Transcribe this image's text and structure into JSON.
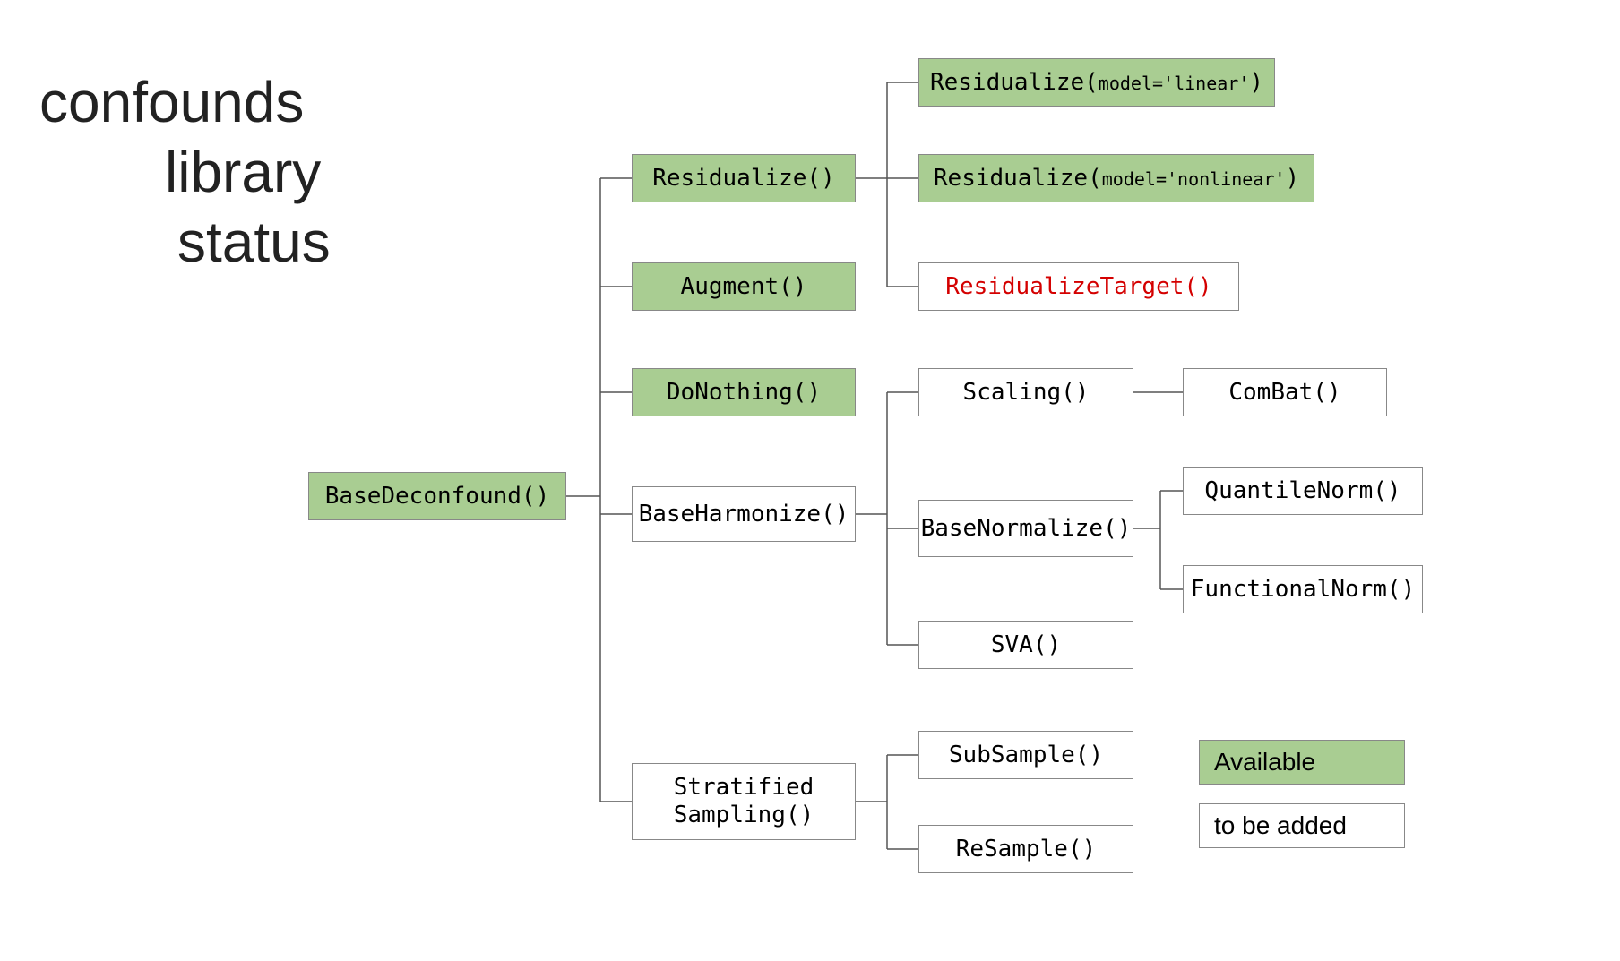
{
  "title": {
    "l1": "confounds",
    "l2": "library",
    "l3": "status"
  },
  "nodes": {
    "base": "BaseDeconfound()",
    "residualize": "Residualize()",
    "augment": "Augment()",
    "donothing": "DoNothing()",
    "baseharmonize": "BaseHarmonize()",
    "stratified_l1": "Stratified",
    "stratified_l2": "Sampling()",
    "residualize_linear_pre": "Residualize(",
    "residualize_linear_param": "model='linear'",
    "residualize_linear_post": ")",
    "residualize_nonlinear_pre": "Residualize(",
    "residualize_nonlinear_param": "model='nonlinear'",
    "residualize_nonlinear_post": ")",
    "residualize_target": "ResidualizeTarget()",
    "scaling": "Scaling()",
    "basenormalize": "BaseNormalize()",
    "sva": "SVA()",
    "subsample": "SubSample()",
    "resample": "ReSample()",
    "combat": "ComBat()",
    "quantilenorm": "QuantileNorm()",
    "functionalnorm": "FunctionalNorm()"
  },
  "legend": {
    "available": "Available",
    "tobeadded": "to be added"
  }
}
